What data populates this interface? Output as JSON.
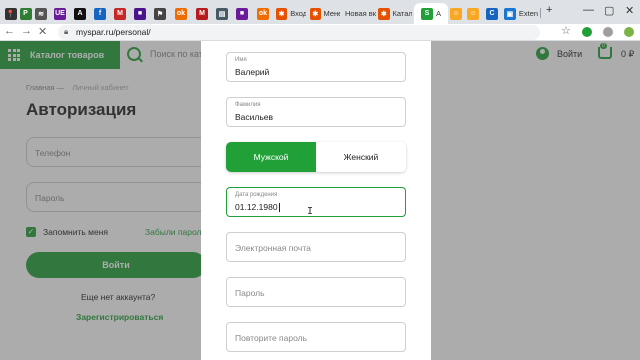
{
  "browser": {
    "tabs": [
      {
        "icon": "pin-icon",
        "title": "",
        "color": "#333333"
      },
      {
        "icon": "p-icon",
        "title": "",
        "color": "#2e7d32"
      },
      {
        "icon": "layers-icon",
        "title": "",
        "color": "#555555"
      },
      {
        "icon": "ue-icon",
        "title": "",
        "color": "#6a1b9a"
      },
      {
        "icon": "a-icon",
        "title": "",
        "color": "#111111"
      },
      {
        "icon": "facebook-icon",
        "title": "",
        "color": "#1565c0"
      },
      {
        "icon": "gmail-icon",
        "title": "",
        "color": "#c62828"
      },
      {
        "icon": "square-icon",
        "title": "",
        "color": "#4a148c"
      },
      {
        "icon": "runner-icon",
        "title": "",
        "color": "#444444"
      },
      {
        "icon": "ok-icon",
        "title": "",
        "color": "#ef6c00"
      },
      {
        "icon": "m-icon",
        "title": "",
        "color": "#b71c1c"
      },
      {
        "icon": "doc-icon",
        "title": "",
        "color": "#455a64"
      },
      {
        "icon": "square-icon",
        "title": "",
        "color": "#6a1b9a"
      },
      {
        "icon": "ok-icon",
        "title": "",
        "color": "#ef6c00"
      },
      {
        "icon": "joomla-icon",
        "title": "Вход",
        "color": "#e65100"
      },
      {
        "icon": "joomla-icon",
        "title": "Мене",
        "color": "#e65100"
      },
      {
        "icon": "none",
        "title": "Новая вк",
        "color": "#999999"
      },
      {
        "icon": "joomla-icon",
        "title": "Катал",
        "color": "#e65100"
      },
      {
        "icon": "spar-icon",
        "title": "А",
        "color": "#21a038"
      },
      {
        "icon": "emoji-icon",
        "title": "",
        "color": "#f9a825"
      },
      {
        "icon": "emoji-icon",
        "title": "",
        "color": "#f9a825"
      },
      {
        "icon": "c-icon",
        "title": "",
        "color": "#1565c0"
      },
      {
        "icon": "tab-icon",
        "title": "Exten",
        "color": "#1976d2"
      }
    ],
    "new_tab": "+",
    "url": "myspar.ru/personal/"
  },
  "header": {
    "catalog_label": "Каталог товаров",
    "search_placeholder": "Поиск по ката",
    "login_label": "Войти",
    "cart_count": "0",
    "cart_sum": "0 ₽"
  },
  "page": {
    "breadcrumb_home": "Главная",
    "breadcrumb_current": "Личный кабинет",
    "title": "Авторизация",
    "phone_placeholder": "Телефон",
    "password_placeholder": "Пароль",
    "remember_label": "Запомнить меня",
    "forgot_label": "Забыли парол",
    "login_button": "Войти",
    "no_account": "Еще нет аккаунта?",
    "register_link": "Зарегистрироваться"
  },
  "modal": {
    "first_name": {
      "label": "Имя",
      "value": "Валерий"
    },
    "last_name": {
      "label": "Фамилия",
      "value": "Васильев"
    },
    "gender": {
      "male": "Мужской",
      "female": "Женский",
      "selected": "male"
    },
    "birth_date": {
      "label": "Дата рождения",
      "value": "01.12.1980"
    },
    "email_placeholder": "Электронная почта",
    "password_placeholder": "Пароль",
    "repeat_password_placeholder": "Повторите пароль"
  },
  "colors": {
    "brand": "#21a038"
  }
}
